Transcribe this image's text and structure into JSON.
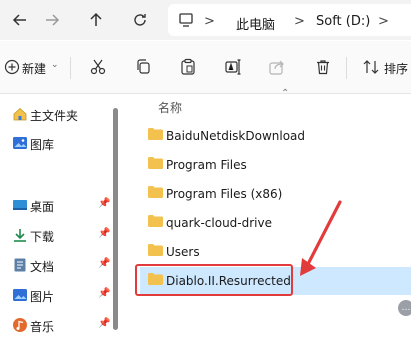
{
  "address_bar": {
    "crumbs": [
      "此电脑",
      "Soft (D:)"
    ],
    "separators": [
      ">",
      ">",
      ">"
    ]
  },
  "toolbar": {
    "new_label": "新建",
    "sort_label": "排序",
    "icons": [
      "new-icon",
      "cut-icon",
      "copy-icon",
      "paste-icon",
      "rename-icon",
      "share-icon",
      "delete-icon",
      "sort-icon"
    ]
  },
  "nav": {
    "items": [
      {
        "label": "主文件夹",
        "icon": "home-icon"
      },
      {
        "label": "图库",
        "icon": "gallery-icon"
      },
      {
        "label": "桌面",
        "icon": "desktop-icon"
      },
      {
        "label": "下载",
        "icon": "download-icon"
      },
      {
        "label": "文档",
        "icon": "documents-icon"
      },
      {
        "label": "图片",
        "icon": "pictures-icon"
      },
      {
        "label": "音乐",
        "icon": "music-icon"
      }
    ]
  },
  "files": {
    "column_name": "名称",
    "rows": [
      {
        "name": "BaiduNetdiskDownload"
      },
      {
        "name": "Program Files"
      },
      {
        "name": "Program Files (x86)"
      },
      {
        "name": "quark-cloud-drive"
      },
      {
        "name": "Users"
      },
      {
        "name": "Diablo.II.Resurrected"
      }
    ],
    "selected_index": 5
  },
  "colors": {
    "selection": "#cde8ff",
    "annotation": "#e23b3b",
    "folder": "#f2c14e"
  }
}
